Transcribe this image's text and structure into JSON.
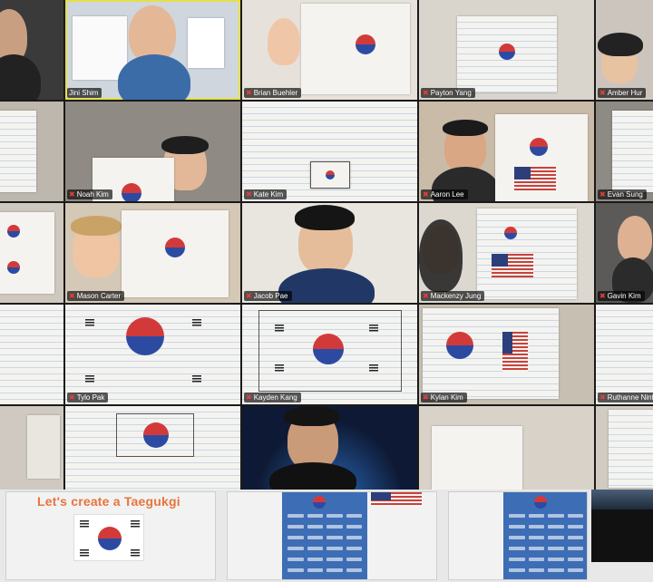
{
  "participants": [
    {
      "name": "Jini Shim",
      "muted": false,
      "active": true
    },
    {
      "name": "Brian Buehler",
      "muted": true
    },
    {
      "name": "Payton Yang",
      "muted": true
    },
    {
      "name": "Amber Hur",
      "muted": true
    },
    {
      "name": "Noah Kim",
      "muted": true
    },
    {
      "name": "Kate Kim",
      "muted": true
    },
    {
      "name": "Aaron Lee",
      "muted": true
    },
    {
      "name": "Evan Sung",
      "muted": true
    },
    {
      "name": "Mason Carter",
      "muted": true
    },
    {
      "name": "Jacob Pae",
      "muted": true
    },
    {
      "name": "Mackenzy Jung",
      "muted": true
    },
    {
      "name": "Gavin Kim",
      "muted": true
    },
    {
      "name": "Tylo Pak",
      "muted": true
    },
    {
      "name": "Kayden Kang",
      "muted": true
    },
    {
      "name": "Kylan Kim",
      "muted": true
    },
    {
      "name": "Ruthanne Ninfa",
      "muted": true
    }
  ],
  "slides": {
    "slide1_title": "Let's create a Taegukgi"
  },
  "colors": {
    "active_border": "#e6df4a",
    "mic_off": "#e2403c",
    "slide_title": "#e8743b",
    "flag_red": "#d23a3a",
    "flag_blue": "#2d4aa3"
  },
  "icons": {
    "muted": "mic-off-icon"
  }
}
